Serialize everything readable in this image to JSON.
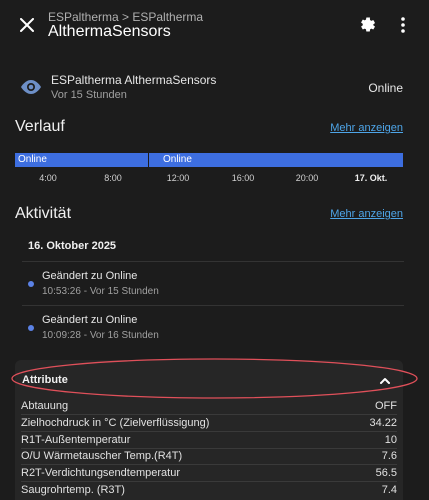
{
  "header": {
    "breadcrumb": "ESPaltherma > ESPaltherma",
    "title": "AlthermaSensors"
  },
  "entity": {
    "name": "ESPaltherma AlthermaSensors",
    "last_changed": "Vor 15 Stunden",
    "state": "Online"
  },
  "history": {
    "title": "Verlauf",
    "more_link": "Mehr anzeigen",
    "segments": [
      "Online",
      "Online"
    ],
    "ticks": [
      "4:00",
      "8:00",
      "12:00",
      "16:00",
      "20:00",
      "17. Okt."
    ],
    "segment_color": "#3d6ee0"
  },
  "activity": {
    "title": "Aktivität",
    "more_link": "Mehr anzeigen",
    "date": "16. Oktober 2025",
    "items": [
      {
        "label": "Geändert zu Online",
        "time": "10:53:26 - Vor 15 Stunden"
      },
      {
        "label": "Geändert zu Online",
        "time": "10:09:28 - Vor 16 Stunden"
      }
    ]
  },
  "attributes": {
    "title": "Attribute",
    "rows": [
      {
        "key": "Abtauung",
        "value": "OFF"
      },
      {
        "key": "Zielhochdruck in °C (Zielverflüssigung)",
        "value": "34.22"
      },
      {
        "key": "R1T-Außentemperatur",
        "value": "10"
      },
      {
        "key": "O/U Wärmetauscher Temp.(R4T)",
        "value": "7.6"
      },
      {
        "key": "R2T-Verdichtungsendtemperatur",
        "value": "56.5"
      },
      {
        "key": "Saugrohrtemp. (R3T)",
        "value": "7.4"
      }
    ]
  },
  "colors": {
    "accent": "#4ea5e8",
    "highlight": "#e0505a"
  }
}
